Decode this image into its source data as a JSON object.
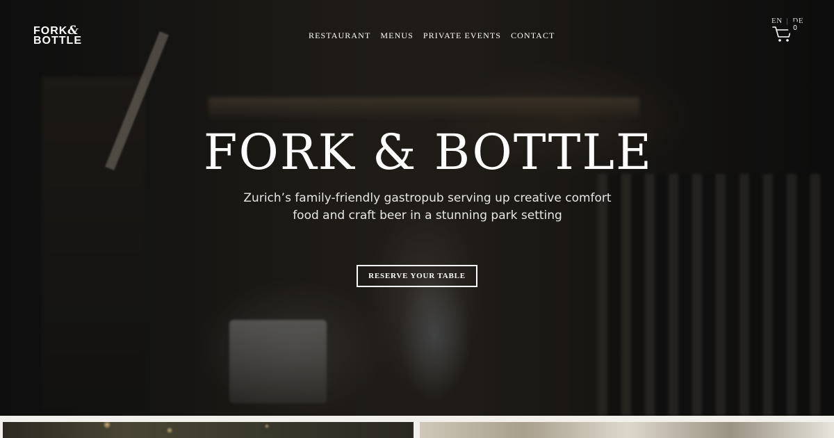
{
  "brand": {
    "logo_line1": "FORK",
    "logo_amp": "&",
    "logo_line2": "BOTTLE"
  },
  "nav": {
    "items": [
      {
        "label": "RESTAURANT"
      },
      {
        "label": "MENUS"
      },
      {
        "label": "PRIVATE EVENTS"
      },
      {
        "label": "CONTACT"
      }
    ]
  },
  "language": {
    "current": "EN",
    "separator": "|",
    "other": "DE"
  },
  "cart": {
    "icon": "cart-icon",
    "count": "0"
  },
  "hero": {
    "title": "FORK & BOTTLE",
    "subtitle_line1": "Zurich’s family-friendly gastropub serving up creative comfort",
    "subtitle_line2": "food and craft beer in a stunning park setting",
    "cta_label": "RESERVE YOUR TABLE"
  },
  "colors": {
    "text": "#ffffff",
    "page_background": "#f2f0ec",
    "hero_overlay": "#000000"
  }
}
